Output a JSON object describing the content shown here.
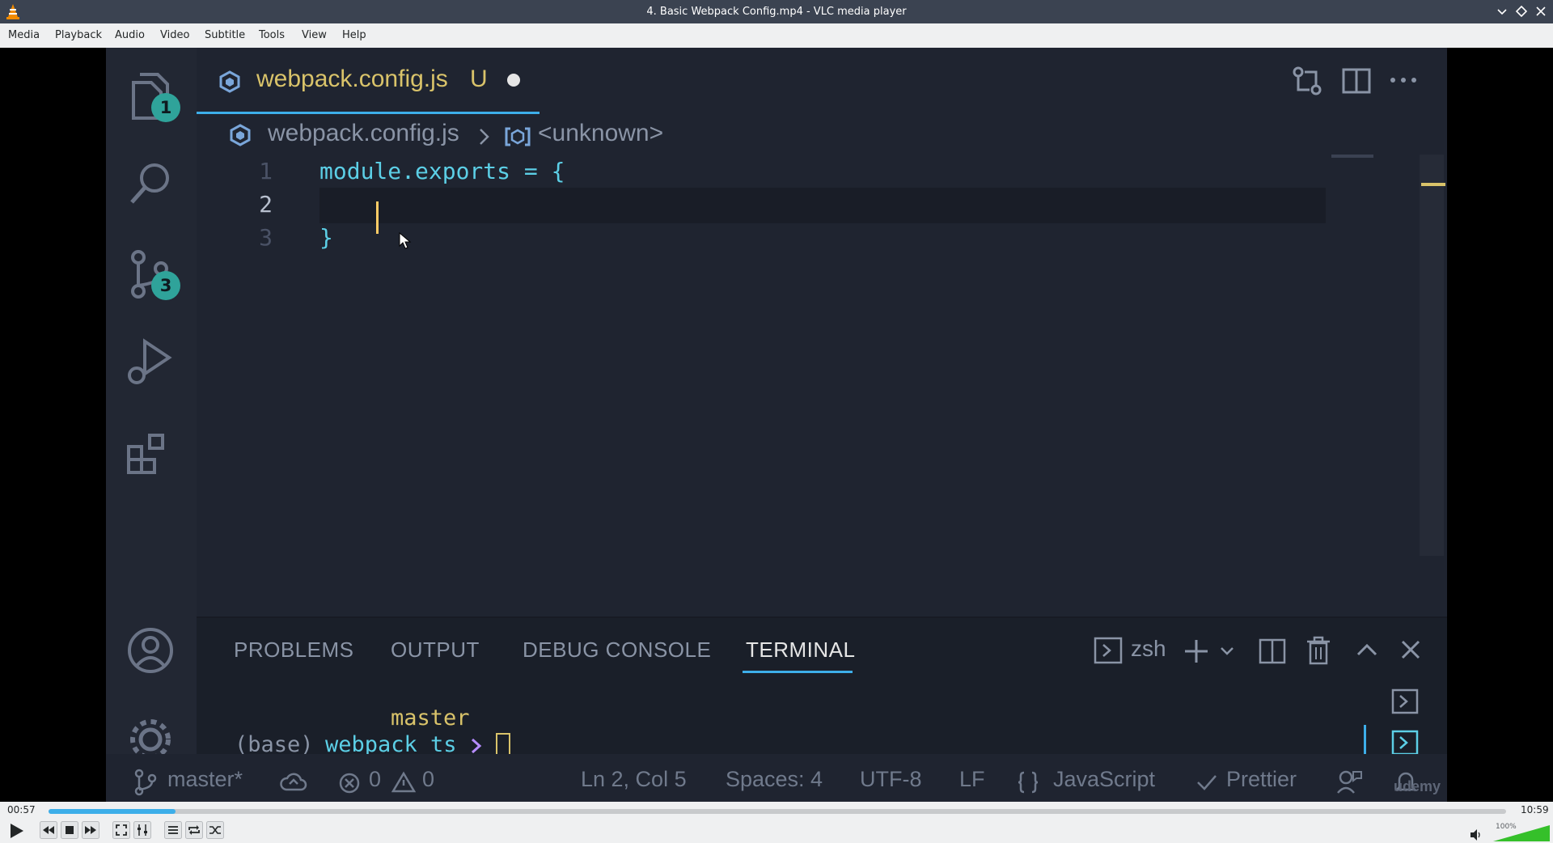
{
  "window": {
    "title": "4. Basic Webpack Config.mp4 - VLC media player"
  },
  "menu": [
    "Media",
    "Playback",
    "Audio",
    "Video",
    "Subtitle",
    "Tools",
    "View",
    "Help"
  ],
  "vscode": {
    "activity": {
      "explorer_badge": "1",
      "scm_badge": "3"
    },
    "tab": {
      "filename": "webpack.config.js",
      "status": "U"
    },
    "breadcrumb": {
      "file": "webpack.config.js",
      "symbol": "<unknown>"
    },
    "lines": [
      {
        "num": "1",
        "text": "module.exports = {"
      },
      {
        "num": "2",
        "text": ""
      },
      {
        "num": "3",
        "text": "}"
      }
    ],
    "panel": {
      "tabs": [
        "PROBLEMS",
        "OUTPUT",
        "DEBUG CONSOLE",
        "TERMINAL"
      ],
      "active_tab": "TERMINAL",
      "shell": "zsh",
      "terminal_branch": "master",
      "terminal_env": "(base)",
      "terminal_dir": "webpack_ts"
    },
    "status": {
      "branch": "master*",
      "errors": "0",
      "warnings": "0",
      "position": "Ln 2, Col 5",
      "spaces": "Spaces: 4",
      "encoding": "UTF-8",
      "eol": "LF",
      "language": "JavaScript",
      "formatter": "Prettier",
      "watermark": "udemy"
    }
  },
  "player": {
    "elapsed": "00:57",
    "total": "10:59",
    "progress_fraction": 0.087,
    "volume_label": "100%",
    "volume_fraction": 1.0
  },
  "colors": {
    "accent": "#3daee9",
    "badge": "#2fa39a",
    "vscode_bg": "#1f2430",
    "tab_text": "#d9c36a"
  }
}
